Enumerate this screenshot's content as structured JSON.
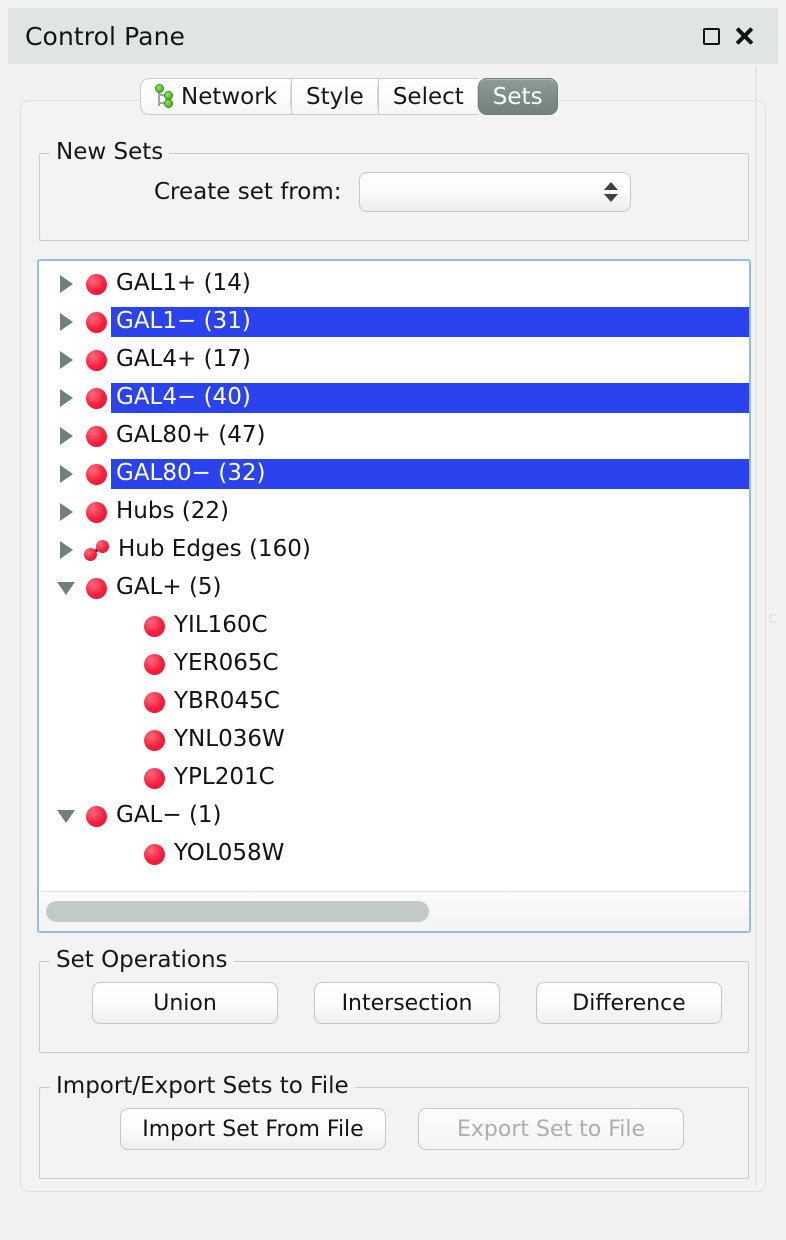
{
  "window": {
    "title": "Control Pane",
    "maximize_icon": "square-outline-icon",
    "close_icon": "close-x-icon"
  },
  "tabs": [
    {
      "label": "Network",
      "icon": "network-graph-icon",
      "active": false
    },
    {
      "label": "Style",
      "icon": "",
      "active": false
    },
    {
      "label": "Select",
      "icon": "",
      "active": false
    },
    {
      "label": "Sets",
      "icon": "",
      "active": true
    }
  ],
  "new_sets": {
    "legend": "New Sets",
    "create_label": "Create set from:",
    "combo_value": "",
    "combo_placeholder": ""
  },
  "tree": {
    "rows": [
      {
        "label": "GAL1+ (14)",
        "icon": "node-icon",
        "expanded": false,
        "selected": false,
        "child": false
      },
      {
        "label": "GAL1− (31)",
        "icon": "node-icon",
        "expanded": false,
        "selected": true,
        "child": false
      },
      {
        "label": "GAL4+ (17)",
        "icon": "node-icon",
        "expanded": false,
        "selected": false,
        "child": false
      },
      {
        "label": "GAL4− (40)",
        "icon": "node-icon",
        "expanded": false,
        "selected": true,
        "child": false
      },
      {
        "label": "GAL80+ (47)",
        "icon": "node-icon",
        "expanded": false,
        "selected": false,
        "child": false
      },
      {
        "label": "GAL80− (32)",
        "icon": "node-icon",
        "expanded": false,
        "selected": true,
        "child": false
      },
      {
        "label": "Hubs (22)",
        "icon": "node-icon",
        "expanded": false,
        "selected": false,
        "child": false
      },
      {
        "label": "Hub Edges (160)",
        "icon": "edge-icon",
        "expanded": false,
        "selected": false,
        "child": false
      },
      {
        "label": "GAL+ (5)",
        "icon": "node-icon",
        "expanded": true,
        "selected": false,
        "child": false
      },
      {
        "label": "YIL160C",
        "icon": "node-icon",
        "expanded": null,
        "selected": false,
        "child": true
      },
      {
        "label": "YER065C",
        "icon": "node-icon",
        "expanded": null,
        "selected": false,
        "child": true
      },
      {
        "label": "YBR045C",
        "icon": "node-icon",
        "expanded": null,
        "selected": false,
        "child": true
      },
      {
        "label": "YNL036W",
        "icon": "node-icon",
        "expanded": null,
        "selected": false,
        "child": true
      },
      {
        "label": "YPL201C",
        "icon": "node-icon",
        "expanded": null,
        "selected": false,
        "child": true
      },
      {
        "label": "GAL− (1)",
        "icon": "node-icon",
        "expanded": true,
        "selected": false,
        "child": false
      },
      {
        "label": "YOL058W",
        "icon": "node-icon",
        "expanded": null,
        "selected": false,
        "child": true
      }
    ],
    "scroll_thumb_fraction": 0.55
  },
  "set_operations": {
    "legend": "Set Operations",
    "union": "Union",
    "intersection": "Intersection",
    "difference": "Difference"
  },
  "import_export": {
    "legend": "Import/Export Sets to File",
    "import": "Import Set From File",
    "export": "Export Set to File",
    "export_disabled": true
  },
  "colors": {
    "selection_blue": "#2a43ef",
    "node_red": "#f8213f",
    "titlebar": "#dee5e2",
    "panel": "#f2f3f2",
    "tab_active": "#7e8d8a",
    "list_border": "#93bde4"
  },
  "artifacts": {
    "ghost_char": "c"
  }
}
